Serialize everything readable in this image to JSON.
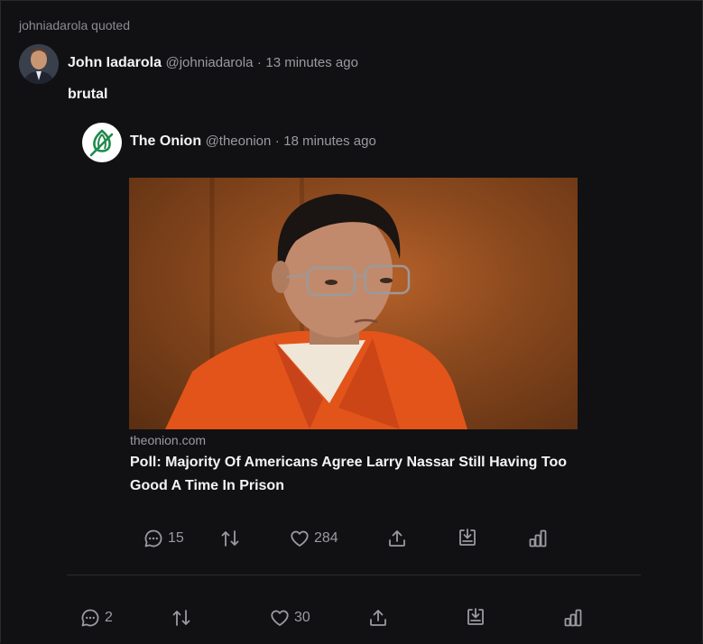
{
  "quoted_header": "johniadarola quoted",
  "post": {
    "author_name": "John Iadarola",
    "handle": "@johniadarola",
    "separator": "·",
    "time": "13 minutes ago",
    "text": "brutal",
    "reply_count": "2",
    "like_count": "30"
  },
  "quoted_post": {
    "author_name": "The Onion",
    "handle": "@theonion",
    "separator": "·",
    "time": "18 minutes ago",
    "link_domain": "theonion.com",
    "link_title": "Poll: Majority Of Americans Agree Larry Nassar Still Having Too Good A Time In Prison",
    "reply_count": "15",
    "like_count": "284"
  },
  "icons": {
    "reply": "comment-icon",
    "repost": "repost-icon",
    "like": "heart-icon",
    "share": "share-icon",
    "save": "bookmark-icon",
    "stats": "stats-icon"
  },
  "colors": {
    "background": "#111113",
    "muted_text": "#9a9aa2",
    "onion_green": "#1f8a4c"
  }
}
